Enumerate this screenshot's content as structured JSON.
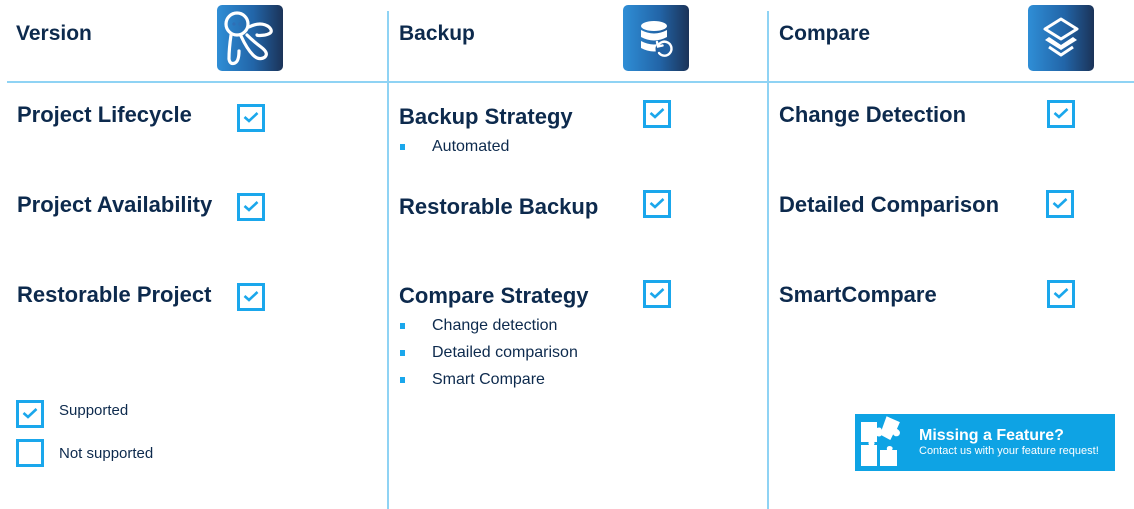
{
  "columns": [
    {
      "title": "Version",
      "icon": "octopus-icon",
      "features": [
        {
          "label": "Project Lifecycle",
          "supported": true,
          "bullets": []
        },
        {
          "label": "Project Availability",
          "supported": true,
          "bullets": []
        },
        {
          "label": "Restorable Project",
          "supported": true,
          "bullets": []
        }
      ]
    },
    {
      "title": "Backup",
      "icon": "database-restore-icon",
      "features": [
        {
          "label": "Backup Strategy",
          "supported": true,
          "bullets": [
            "Automated"
          ]
        },
        {
          "label": "Restorable Backup",
          "supported": true,
          "bullets": []
        },
        {
          "label": "Compare Strategy",
          "supported": true,
          "bullets": [
            "Change detection",
            "Detailed comparison",
            "Smart Compare"
          ]
        }
      ]
    },
    {
      "title": "Compare",
      "icon": "layers-icon",
      "features": [
        {
          "label": "Change Detection",
          "supported": true,
          "bullets": []
        },
        {
          "label": "Detailed Comparison",
          "supported": true,
          "bullets": []
        },
        {
          "label": "SmartCompare",
          "supported": true,
          "bullets": []
        }
      ]
    }
  ],
  "legend": {
    "supported_label": "Supported",
    "not_supported_label": "Not supported"
  },
  "banner": {
    "title": "Missing a Feature?",
    "subtitle": "Contact us with your feature request!",
    "icon": "puzzle-icon"
  },
  "colors": {
    "text": "#0d2a4d",
    "accent": "#1aa7ec",
    "divider": "#8fd3f4",
    "banner_bg": "#0ea3e4"
  }
}
